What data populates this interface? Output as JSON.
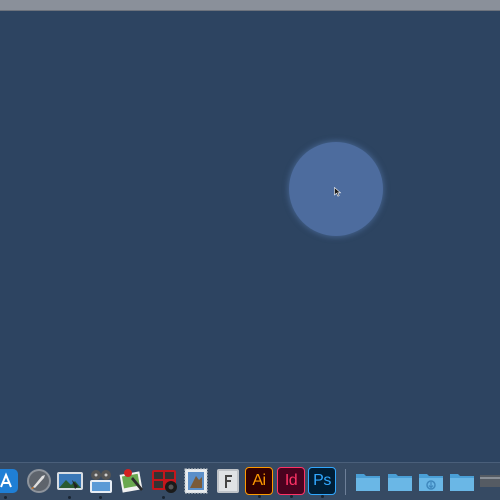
{
  "desktop": {
    "background_color": "#2d4461"
  },
  "menubar": {
    "color": "#8a909a"
  },
  "cursor_highlight": {
    "color": "#4d6c9e"
  },
  "dock": {
    "background_color": "#364a63",
    "apps": [
      {
        "name": "app-store-icon",
        "icon": "app-store-icon"
      },
      {
        "name": "launchpad-icon",
        "icon": "rocket-icon"
      },
      {
        "name": "photo-editor-icon",
        "icon": "photo-icon"
      },
      {
        "name": "video-tool-icon",
        "icon": "film-reel-icon"
      },
      {
        "name": "preview-icon",
        "icon": "image-pen-icon"
      },
      {
        "name": "photo-booth-icon",
        "icon": "photo-strip-icon"
      },
      {
        "name": "mail-stamp-icon",
        "icon": "stamp-icon"
      },
      {
        "name": "font-app-icon",
        "icon": "font-icon"
      }
    ],
    "adobe": {
      "illustrator": {
        "label": "Ai",
        "color": "#ff9a00",
        "bg": "#330000"
      },
      "indesign": {
        "label": "Id",
        "color": "#ff3366",
        "bg": "#49021f"
      },
      "photoshop": {
        "label": "Ps",
        "color": "#31a8ff",
        "bg": "#001e36"
      }
    },
    "folders": [
      {
        "name": "folder-1"
      },
      {
        "name": "folder-2"
      },
      {
        "name": "downloads-folder"
      },
      {
        "name": "folder-4"
      }
    ]
  }
}
